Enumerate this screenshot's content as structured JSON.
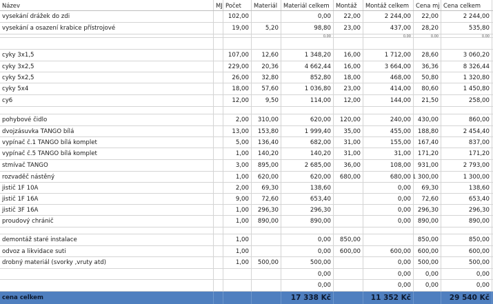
{
  "header": {
    "nazev": "Název",
    "mj": "MJ",
    "pocet": "Počet",
    "material": "Materiál",
    "material_celkem": "Materiál celkem",
    "montaz": "Montáž",
    "montaz_celkem": "Montáž celkem",
    "cena_mj": "Cena mj",
    "cena_celkem": "Cena celkem"
  },
  "rows": [
    {
      "nazev": "vysekání drážek  do zdi",
      "mj": "",
      "pocet": "102,00",
      "material": "",
      "material_celkem": "0,00",
      "montaz": "22,00",
      "montaz_celkem": "2 244,00",
      "cena_mj": "22,00",
      "cena_celkem": "2 244,00"
    },
    {
      "nazev": "vysekání a osazení krabice přístrojové",
      "mj": "",
      "pocet": "19,00",
      "material": "5,20",
      "material_celkem": "98,80",
      "montaz": "23,00",
      "montaz_celkem": "437,00",
      "cena_mj": "28,20",
      "cena_celkem": "535,80"
    },
    {
      "nazev": "",
      "mj": "",
      "pocet": "",
      "material": "",
      "material_celkem": "0,00",
      "montaz": "",
      "montaz_celkem": "0,00",
      "cena_mj": "0,00",
      "cena_celkem": "0,00"
    },
    {
      "nazev": "",
      "mj": "",
      "pocet": "",
      "material": "",
      "material_celkem": "",
      "montaz": "",
      "montaz_celkem": "",
      "cena_mj": "",
      "cena_celkem": ""
    },
    {
      "nazev": "cyky 3x1,5",
      "mj": "",
      "pocet": "107,00",
      "material": "12,60",
      "material_celkem": "1 348,20",
      "montaz": "16,00",
      "montaz_celkem": "1 712,00",
      "cena_mj": "28,60",
      "cena_celkem": "3 060,20"
    },
    {
      "nazev": "cyky 3x2,5",
      "mj": "",
      "pocet": "229,00",
      "material": "20,36",
      "material_celkem": "4 662,44",
      "montaz": "16,00",
      "montaz_celkem": "3 664,00",
      "cena_mj": "36,36",
      "cena_celkem": "8 326,44"
    },
    {
      "nazev": "cyky 5x2,5",
      "mj": "",
      "pocet": "26,00",
      "material": "32,80",
      "material_celkem": "852,80",
      "montaz": "18,00",
      "montaz_celkem": "468,00",
      "cena_mj": "50,80",
      "cena_celkem": "1 320,80"
    },
    {
      "nazev": "cyky 5x4",
      "mj": "",
      "pocet": "18,00",
      "material": "57,60",
      "material_celkem": "1 036,80",
      "montaz": "23,00",
      "montaz_celkem": "414,00",
      "cena_mj": "80,60",
      "cena_celkem": "1 450,80"
    },
    {
      "nazev": "cy6",
      "mj": "",
      "pocet": "12,00",
      "material": "9,50",
      "material_celkem": "114,00",
      "montaz": "12,00",
      "montaz_celkem": "144,00",
      "cena_mj": "21,50",
      "cena_celkem": "258,00"
    },
    {
      "nazev": "",
      "mj": "",
      "pocet": "",
      "material": "",
      "material_celkem": "",
      "montaz": "",
      "montaz_celkem": "",
      "cena_mj": "",
      "cena_celkem": ""
    },
    {
      "nazev": "pohybové čidlo",
      "mj": "",
      "pocet": "2,00",
      "material": "310,00",
      "material_celkem": "620,00",
      "montaz": "120,00",
      "montaz_celkem": "240,00",
      "cena_mj": "430,00",
      "cena_celkem": "860,00"
    },
    {
      "nazev": "dvojzásuvka TANGO bílá",
      "mj": "",
      "pocet": "13,00",
      "material": "153,80",
      "material_celkem": "1 999,40",
      "montaz": "35,00",
      "montaz_celkem": "455,00",
      "cena_mj": "188,80",
      "cena_celkem": "2 454,40"
    },
    {
      "nazev": "vypínač č.1 TANGO bílá komplet",
      "mj": "",
      "pocet": "5,00",
      "material": "136,40",
      "material_celkem": "682,00",
      "montaz": "31,00",
      "montaz_celkem": "155,00",
      "cena_mj": "167,40",
      "cena_celkem": "837,00"
    },
    {
      "nazev": "vypínač č.5 TANGO bílá komplet",
      "mj": "",
      "pocet": "1,00",
      "material": "140,20",
      "material_celkem": "140,20",
      "montaz": "31,00",
      "montaz_celkem": "31,00",
      "cena_mj": "171,20",
      "cena_celkem": "171,20"
    },
    {
      "nazev": "stmívač TANGO",
      "mj": "",
      "pocet": "3,00",
      "material": "895,00",
      "material_celkem": "2 685,00",
      "montaz": "36,00",
      "montaz_celkem": "108,00",
      "cena_mj": "931,00",
      "cena_celkem": "2 793,00"
    },
    {
      "nazev": "rozvaděč nástěný",
      "mj": "",
      "pocet": "1,00",
      "material": "620,00",
      "material_celkem": "620,00",
      "montaz": "680,00",
      "montaz_celkem": "680,00",
      "cena_mj": "1 300,00",
      "cena_celkem": "1 300,00"
    },
    {
      "nazev": "jistič 1F 10A",
      "mj": "",
      "pocet": "2,00",
      "material": "69,30",
      "material_celkem": "138,60",
      "montaz": "",
      "montaz_celkem": "0,00",
      "cena_mj": "69,30",
      "cena_celkem": "138,60"
    },
    {
      "nazev": "jistič 1F 16A",
      "mj": "",
      "pocet": "9,00",
      "material": "72,60",
      "material_celkem": "653,40",
      "montaz": "",
      "montaz_celkem": "0,00",
      "cena_mj": "72,60",
      "cena_celkem": "653,40"
    },
    {
      "nazev": "jistič 3F 16A",
      "mj": "",
      "pocet": "1,00",
      "material": "296,30",
      "material_celkem": "296,30",
      "montaz": "",
      "montaz_celkem": "0,00",
      "cena_mj": "296,30",
      "cena_celkem": "296,30"
    },
    {
      "nazev": "proudový chránič",
      "mj": "",
      "pocet": "1,00",
      "material": "890,00",
      "material_celkem": "890,00",
      "montaz": "",
      "montaz_celkem": "0,00",
      "cena_mj": "890,00",
      "cena_celkem": "890,00"
    },
    {
      "nazev": "",
      "mj": "",
      "pocet": "",
      "material": "",
      "material_celkem": "",
      "montaz": "",
      "montaz_celkem": "",
      "cena_mj": "",
      "cena_celkem": ""
    },
    {
      "nazev": "demontáž staré instalace",
      "mj": "",
      "pocet": "1,00",
      "material": "",
      "material_celkem": "0,00",
      "montaz": "850,00",
      "montaz_celkem": "",
      "cena_mj": "850,00",
      "cena_celkem": "850,00"
    },
    {
      "nazev": "odvoz a likvidace suti",
      "mj": "",
      "pocet": "1,00",
      "material": "",
      "material_celkem": "0,00",
      "montaz": "600,00",
      "montaz_celkem": "600,00",
      "cena_mj": "600,00",
      "cena_celkem": "600,00"
    },
    {
      "nazev": "drobný materiál (svorky ,vruty atd)",
      "mj": "",
      "pocet": "1,00",
      "material": "500,00",
      "material_celkem": "500,00",
      "montaz": "",
      "montaz_celkem": "0,00",
      "cena_mj": "500,00",
      "cena_celkem": "500,00"
    },
    {
      "nazev": "",
      "mj": "",
      "pocet": "",
      "material": "",
      "material_celkem": "0,00",
      "montaz": "",
      "montaz_celkem": "0,00",
      "cena_mj": "0,00",
      "cena_celkem": "0,00"
    },
    {
      "nazev": "",
      "mj": "",
      "pocet": "",
      "material": "",
      "material_celkem": "0,00",
      "montaz": "",
      "montaz_celkem": "0,00",
      "cena_mj": "0,00",
      "cena_celkem": "0,00"
    }
  ],
  "total": {
    "nazev": "cena celkem",
    "material_celkem": "17 338 Kč",
    "montaz_celkem": "11 352 Kč",
    "cena_celkem": "29 540 Kč"
  },
  "colors": {
    "total_bar": "#4f7fbf",
    "grid_line": "#d4d4d4"
  }
}
